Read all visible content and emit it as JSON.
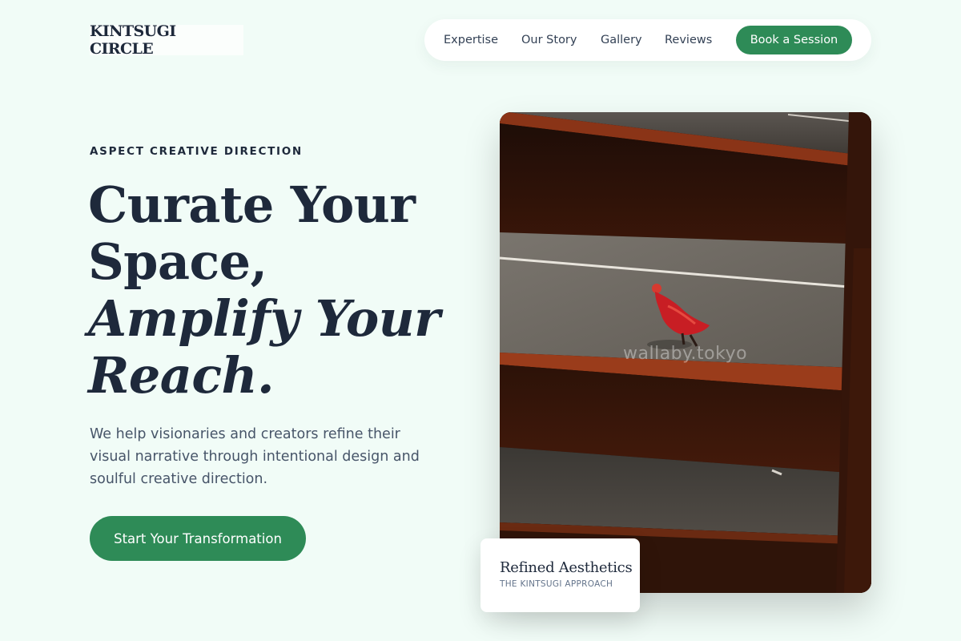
{
  "brand": {
    "logo_text": "KINTSUGI CIRCLE"
  },
  "nav": {
    "links": [
      "Expertise",
      "Our Story",
      "Gallery",
      "Reviews"
    ],
    "cta_label": "Book a Session"
  },
  "hero": {
    "eyebrow": "ASPECT CREATIVE DIRECTION",
    "headline_lines": [
      "Curate Your",
      "Space,"
    ],
    "headline_italic_lines": [
      "Amplify Your",
      "Reach."
    ],
    "lede_lines": [
      "We help visionaries and creators refine their",
      "visual narrative through intentional design and",
      "soulful creative direction."
    ],
    "cta_label": "Start Your Transformation"
  },
  "image": {
    "watermark": "wallaby.tokyo"
  },
  "card": {
    "title": "Refined Aesthetics",
    "subtitle": "THE KINTSUGI APPROACH"
  },
  "colors": {
    "background": "#f1fcf7",
    "accent": "#2e8b57",
    "text": "#1e293b"
  }
}
